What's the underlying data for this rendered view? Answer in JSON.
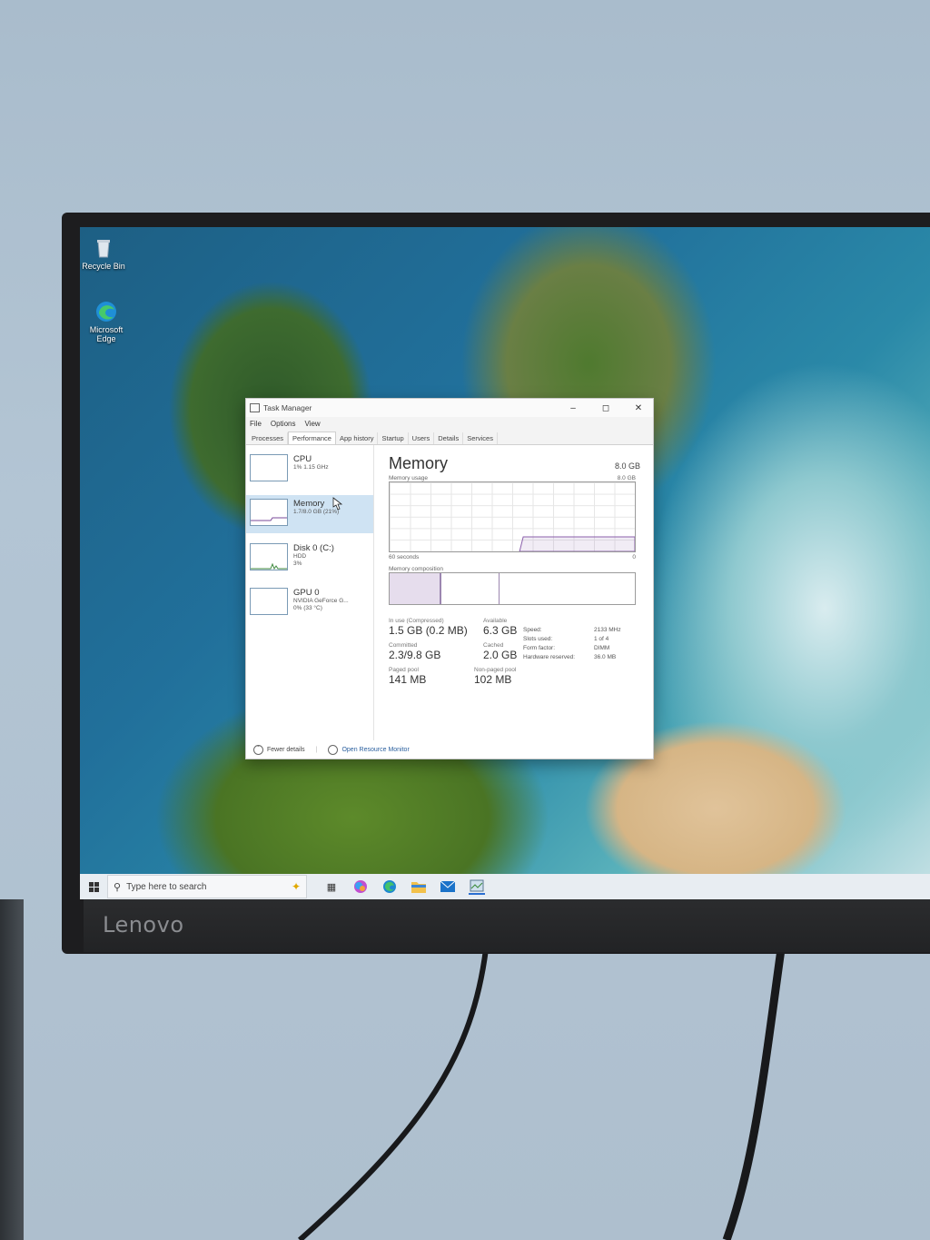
{
  "desktop": {
    "icons": [
      {
        "label": "Recycle Bin",
        "icon": "recycle-bin-icon"
      },
      {
        "label": "Microsoft Edge",
        "icon": "edge-icon"
      }
    ]
  },
  "monitor": {
    "brand": "Lenovo"
  },
  "taskbar": {
    "search_placeholder": "Type here to search",
    "icons": [
      "start-icon",
      "search-icon",
      "copilot-icon",
      "task-view-icon",
      "copilot-app-icon",
      "edge-icon",
      "file-explorer-icon",
      "mail-icon",
      "task-manager-icon"
    ]
  },
  "task_manager": {
    "title": "Task Manager",
    "menu": [
      "File",
      "Options",
      "View"
    ],
    "tabs": [
      "Processes",
      "Performance",
      "App history",
      "Startup",
      "Users",
      "Details",
      "Services"
    ],
    "active_tab": "Performance",
    "sidebar": [
      {
        "label": "CPU",
        "sub1": "1% 1.15 GHz",
        "sub2": ""
      },
      {
        "label": "Memory",
        "sub1": "1.7/8.0 GB (21%)",
        "sub2": ""
      },
      {
        "label": "Disk 0 (C:)",
        "sub1": "HDD",
        "sub2": "3%"
      },
      {
        "label": "GPU 0",
        "sub1": "NVIDIA GeForce G...",
        "sub2": "0% (33 °C)"
      }
    ],
    "main": {
      "title": "Memory",
      "total": "8.0 GB",
      "usage_label": "Memory usage",
      "usage_max": "8.0 GB",
      "time_label": "60 seconds",
      "time_zero": "0",
      "composition_label": "Memory composition",
      "usage_level": 0.21,
      "in_use_label": "In use (Compressed)",
      "in_use_value": "1.5 GB (0.2 MB)",
      "available_label": "Available",
      "available_value": "6.3 GB",
      "committed_label": "Committed",
      "committed_value": "2.3/9.8 GB",
      "cached_label": "Cached",
      "cached_value": "2.0 GB",
      "paged_label": "Paged pool",
      "paged_value": "141 MB",
      "nonpaged_label": "Non-paged pool",
      "nonpaged_value": "102 MB",
      "specs": [
        {
          "k": "Speed:",
          "v": "2133 MHz"
        },
        {
          "k": "Slots used:",
          "v": "1 of 4"
        },
        {
          "k": "Form factor:",
          "v": "DIMM"
        },
        {
          "k": "Hardware reserved:",
          "v": "36.0 MB"
        }
      ]
    },
    "footer": {
      "fewer_details": "Fewer details",
      "open_monitor": "Open Resource Monitor"
    }
  }
}
